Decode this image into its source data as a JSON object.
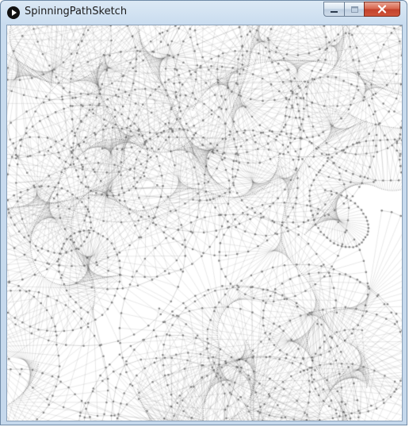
{
  "window": {
    "title": "SpinningPathSketch",
    "app_icon": "play-icon",
    "controls": {
      "minimize_icon": "minimize-icon",
      "maximize_icon": "maximize-icon",
      "close_icon": "close-icon"
    }
  },
  "sketch": {
    "background": "#ffffff",
    "stroke_color": "#000000",
    "dot_color": "#8c8c8c"
  }
}
